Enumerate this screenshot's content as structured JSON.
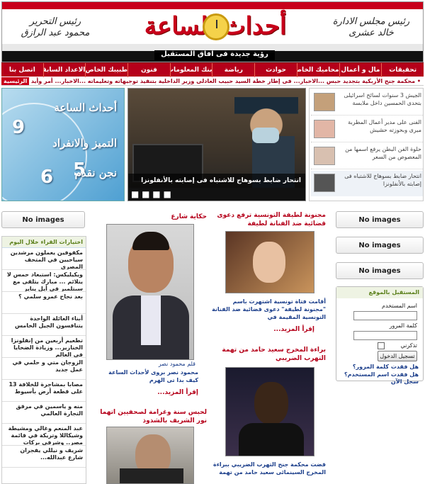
{
  "header": {
    "chairman_title": "رئيس مجلس الادارة",
    "chairman_name": "خالد عشرى",
    "editor_title": "رئيس التحرير",
    "editor_name": "محمود عبد الرازق",
    "logo": "أحداث الساعة",
    "slogan": "رؤية جديدة فى آفاق المستقبل"
  },
  "nav": {
    "items": [
      "تحقيقات",
      "مال و أعمال",
      "محاميك الخاص",
      "حوادث",
      "رياضة",
      "بنك المعلومات",
      "فنون",
      "طبيبك الخاص",
      "الاعداد السابقة",
      "اتصل بنا"
    ]
  },
  "ticker": {
    "text": "• محكمة جنح الأزبكية بتجديد حبس ...الاخبار... فى إطار خطة السيد حبيب العادلى وزير الداخلية بتنفيذ توجيهاته وتعليماته ...الاخبار... أمر وأيد لقرى رئيس نيابة",
    "home_label": "الرئيسية"
  },
  "banner": {
    "line1": "أحداث الساعة",
    "line2": "التميز والانفراد",
    "line3": "نجن نقدم"
  },
  "top_photo": {
    "caption": "انتحار ضابط بسوهاج للاشتباه فى إصابته بالأنفلونزا",
    "dots": "■ ■ ■ ■"
  },
  "top_list": [
    "الجيش 3 سنوات لسائح اسرائيلى بتحدى الحمسين داخل ملابسة",
    "الفنى على مدير أعمال المطربة ميرى وبحوزته حشيش",
    "حلوة الفن البطن يرفع اسمها من المعصوص من السعر",
    "انتحار ضابط بسوهاج للاشتباه فى إصابته بالأنفلونزا"
  ],
  "no_images_label": "No images",
  "left_list": {
    "header": "اختيارات القراء خلال اليوم",
    "items": [
      "مكفوفين يعملون مرشدين سياحيين في المتحف المصري",
      "ويكيليكس: استبعاد حمس لا يتلائم ... مبارك يتلقى مع سبتلمبر في أيل يناير",
      "بعد نجاح عمرو سلمي ؟",
      "أبناء العائلة الواحدة يتنافسون الجيل الخامس",
      "تطعيم أربعين من إنفلونزا الخنازير... وزيادة الضحايا في العالم",
      "الزوجان متي و حلمي في عمل جديد",
      "مصابا بمشاجرة للخلافة 13 على قطعة أرض بأسيوط",
      "منه و ياسمين في مرفق التجارة العالمي",
      "عبد المنعم وغالي ومشيطة وشيكاللا وتريكة في قائمة مصر.. وشرفي بركات خارجها",
      "شريف و نيللي يفجران شارع عبدالله..."
    ]
  },
  "center": {
    "left_title": "حكاية شارع",
    "left_caption": "قلم محمود نصر",
    "left_text": "محمود نصر بروى لأحداث الساعة كيف بدا تى الهرم",
    "left_more": "إقرأ المزيد...",
    "left_title2": "لحبس سنة وغرامة لصحفيين اتهما نور الشريف بالشذوذ",
    "right_title": "مجنونة لطيفة التونسية ترفع دعوى قضائية ضد الفنانة لطيفة",
    "right_text": "أقامت فتاة تونسية اشتهرت باسم \"مجنونة لطيفة\" دعوى قضائية ضد الفنانة التونسية المقيمة في",
    "right_more": "إقرأ المزيد...",
    "right_title2": "براءة المخرج سعيد حامد من تهمة التهرب الضريبي",
    "right_text2": "قضت محكمة جنح التهرب الضريبي ببراءة المخرج السينمائى سعيد حامد من تهمة"
  },
  "login": {
    "header": "المستقبل بالموقع",
    "username_label": "اسم المستخدم",
    "password_label": "كلمة المرور",
    "remember_label": "تذكرني",
    "submit_label": "تسجيل الدخول",
    "forgot_password": "هل فقدت كلمة المرور؟",
    "forgot_username": "هل فقدت اسم المستخدم؟",
    "register": "سجل الآن"
  }
}
